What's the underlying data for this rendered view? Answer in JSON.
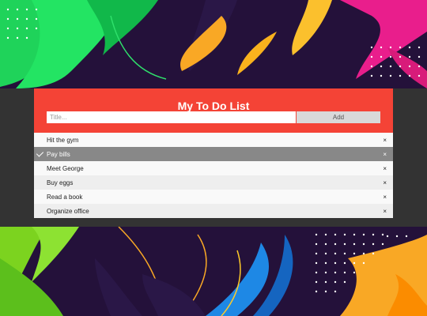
{
  "app": {
    "title": "My To Do List",
    "input_placeholder": "Title...",
    "add_label": "Add"
  },
  "items": [
    {
      "text": "Hit the gym",
      "checked": false,
      "close": "×"
    },
    {
      "text": "Pay bills",
      "checked": true,
      "close": "×"
    },
    {
      "text": "Meet George",
      "checked": false,
      "close": "×"
    },
    {
      "text": "Buy eggs",
      "checked": false,
      "close": "×"
    },
    {
      "text": "Read a book",
      "checked": false,
      "close": "×"
    },
    {
      "text": "Organize office",
      "checked": false,
      "close": "×"
    }
  ],
  "colors": {
    "header": "#f44336",
    "checked_row": "#888888",
    "band": "#333333"
  }
}
